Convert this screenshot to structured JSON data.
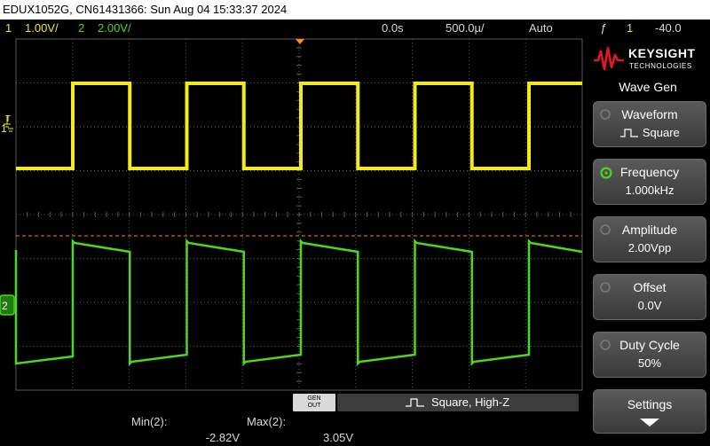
{
  "title": "EDUX1052G, CN61431366: Sun Aug 04 15:33:37 2024",
  "status": {
    "ch1": {
      "number": "1",
      "scale": "1.00V/"
    },
    "ch2": {
      "number": "2",
      "scale": "2.00V/"
    },
    "delay": "0.0s",
    "timebase": "500.0µ/",
    "trigger_mode": "Auto",
    "trigger_slope": "ƒ",
    "trigger_ch": "1",
    "trigger_level": "-40.0"
  },
  "markers": {
    "trigger": "T",
    "ch1": "1",
    "ch2": "2"
  },
  "generator": {
    "gen_out_top": "GEN",
    "gen_out_bottom": "OUT",
    "info": "Square, High-Z"
  },
  "measurements": [
    {
      "label": "Min(2):",
      "value": "-2.82V"
    },
    {
      "label": "Max(2):",
      "value": "3.05V"
    }
  ],
  "panel": {
    "brand": "KEYSIGHT",
    "tagline": "TECHNOLOGIES",
    "menu_title": "Wave Gen",
    "softkeys": [
      {
        "label": "Waveform",
        "value": "Square",
        "icon": "square-wave-icon",
        "active": false
      },
      {
        "label": "Frequency",
        "value": "1.000kHz",
        "icon": "knob-icon",
        "active": true
      },
      {
        "label": "Amplitude",
        "value": "2.00Vpp",
        "icon": "knob-icon",
        "active": false
      },
      {
        "label": "Offset",
        "value": "0.0V",
        "icon": "knob-icon",
        "active": false
      },
      {
        "label": "Duty Cycle",
        "value": "50%",
        "icon": "knob-icon",
        "active": false
      },
      {
        "label": "Settings",
        "icon": "down-arrow-icon"
      }
    ]
  },
  "colors": {
    "ch1": "#f2ea1f",
    "ch2": "#4fd61e",
    "trigger_level_line": "#ff7a1a",
    "grid": "#5a5a5a"
  }
}
